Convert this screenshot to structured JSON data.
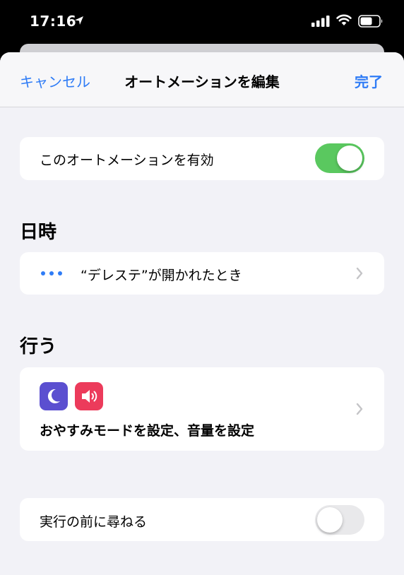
{
  "status_bar": {
    "time": "17:16",
    "icons": [
      "location-arrow-icon",
      "cellular-signal-icon",
      "wifi-icon",
      "battery-icon"
    ]
  },
  "nav": {
    "cancel_label": "キャンセル",
    "title": "オートメーションを編集",
    "done_label": "完了"
  },
  "enable_row": {
    "label": "このオートメーションを有効",
    "enabled": true
  },
  "trigger_section": {
    "title": "日時",
    "trigger_label": "“デレステ”が開かれたとき",
    "icon": "ellipsis-icon"
  },
  "action_section": {
    "title": "行う",
    "icons": [
      "moon-icon",
      "speaker-icon"
    ],
    "summary": "おやすみモードを設定、音量を設定"
  },
  "ask_row": {
    "label": "実行の前に尋ねる",
    "enabled": false
  },
  "colors": {
    "accent_blue": "#2f7cf6",
    "toggle_green": "#5ac85f",
    "moon_icon_bg": "#5b4fd0",
    "speaker_icon_bg": "#ec3b5b",
    "background": "#f2f2f7"
  }
}
